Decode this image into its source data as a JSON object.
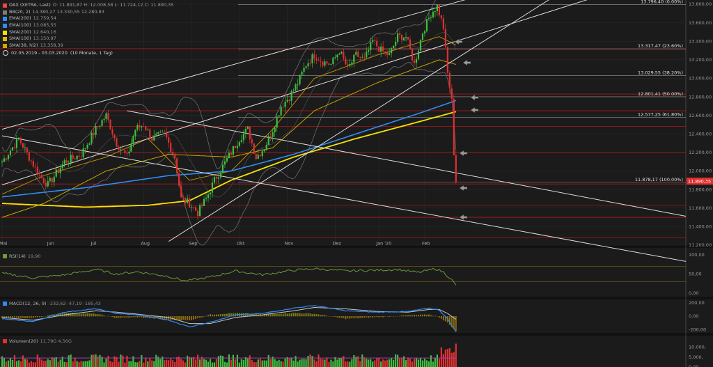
{
  "legend": {
    "main": {
      "name": "DAX (XETRA, Last)",
      "values": "O: 11.891,87  H: 12.008,58  L: 11.724,12  C: 11.890,35",
      "color": "#ff4040"
    },
    "indicators": [
      {
        "name": "BB(20, 2)",
        "values": "14.380,27  13.330,55  12.280,83",
        "color": "#7d7d7d"
      },
      {
        "name": "EMA(200)",
        "values": "12.759,54",
        "color": "#2f8df5"
      },
      {
        "name": "EMA(100)",
        "values": "13.085,55",
        "color": "#2f8df5"
      },
      {
        "name": "SMA(200)",
        "values": "12.640,16",
        "color": "#f5e400"
      },
      {
        "name": "SMA(100)",
        "values": "13.150,97",
        "color": "#e0b800"
      },
      {
        "name": "SMA(38, hl2)",
        "values": "13.358,39",
        "color": "#d9a100"
      }
    ],
    "date_range": "02.05.2019 - 03.03.2020",
    "period": "(10 Monate, 1 Tag)"
  },
  "chart_data": [
    {
      "type": "candlestick",
      "title": "DAX (XETRA, Last)",
      "x": [
        "Mai",
        "Jun",
        "Jul",
        "Aug",
        "Sep",
        "Okt",
        "Nov",
        "Dez",
        "Jan '20",
        "Feb"
      ],
      "y_ticks": [
        "13.800,00",
        "13.600,00",
        "13.400,00",
        "13.200,00",
        "13.000,00",
        "12.800,00",
        "12.600,00",
        "12.400,00",
        "12.200,00",
        "12.000,00",
        "11.800,00",
        "11.600,00",
        "11.400,00",
        "11.200,00"
      ],
      "ylim": [
        11200,
        13800
      ],
      "last_price": "11.890,35",
      "fib_levels": [
        {
          "label": "13.796,40 (0.00%)",
          "value": 13796.4
        },
        {
          "label": "13.317,47 (23.60%)",
          "value": 13317.47
        },
        {
          "label": "13.029,55 (38.20%)",
          "value": 13029.55
        },
        {
          "label": "12.801,41 (50.00%)",
          "value": 12801.41
        },
        {
          "label": "12.577,25 (61.80%)",
          "value": 12577.25
        },
        {
          "label": "11.878,17 (100.00%)",
          "value": 11878.17
        }
      ],
      "support_resistance": [
        13320,
        12830,
        12650,
        12480,
        12200,
        11860,
        11630,
        11500,
        11280
      ],
      "close_anchors": [
        [
          0,
          12100
        ],
        [
          8,
          12350
        ],
        [
          18,
          11950
        ],
        [
          22,
          11850
        ],
        [
          30,
          12100
        ],
        [
          38,
          12180
        ],
        [
          45,
          12450
        ],
        [
          50,
          12600
        ],
        [
          55,
          12300
        ],
        [
          60,
          12150
        ],
        [
          64,
          12450
        ],
        [
          68,
          12500
        ],
        [
          72,
          12350
        ],
        [
          78,
          12400
        ],
        [
          83,
          12150
        ],
        [
          86,
          11700
        ],
        [
          90,
          11650
        ],
        [
          94,
          11550
        ],
        [
          98,
          11700
        ],
        [
          102,
          11900
        ],
        [
          106,
          12050
        ],
        [
          110,
          12200
        ],
        [
          114,
          12350
        ],
        [
          118,
          12450
        ],
        [
          122,
          12150
        ],
        [
          126,
          12250
        ],
        [
          130,
          12450
        ],
        [
          134,
          12700
        ],
        [
          138,
          12800
        ],
        [
          142,
          12950
        ],
        [
          146,
          13150
        ],
        [
          150,
          13250
        ],
        [
          154,
          13180
        ],
        [
          158,
          13150
        ],
        [
          162,
          13300
        ],
        [
          166,
          13100
        ],
        [
          170,
          13250
        ],
        [
          174,
          13200
        ],
        [
          178,
          13400
        ],
        [
          182,
          13300
        ],
        [
          186,
          13250
        ],
        [
          190,
          13450
        ],
        [
          194,
          13450
        ],
        [
          198,
          13150
        ],
        [
          202,
          13500
        ],
        [
          206,
          13700
        ],
        [
          209,
          13780
        ],
        [
          212,
          13550
        ],
        [
          214,
          13050
        ],
        [
          216,
          12750
        ],
        [
          217,
          12200
        ],
        [
          218,
          11890
        ]
      ],
      "ema200_anchors": [
        [
          0,
          11720
        ],
        [
          40,
          11820
        ],
        [
          80,
          11950
        ],
        [
          110,
          12000
        ],
        [
          140,
          12180
        ],
        [
          170,
          12400
        ],
        [
          200,
          12620
        ],
        [
          218,
          12760
        ]
      ],
      "sma200_anchors": [
        [
          0,
          11650
        ],
        [
          40,
          11610
        ],
        [
          70,
          11630
        ],
        [
          90,
          11680
        ],
        [
          110,
          11900
        ],
        [
          140,
          12150
        ],
        [
          170,
          12350
        ],
        [
          200,
          12530
        ],
        [
          218,
          12640
        ]
      ],
      "sma100_anchors": [
        [
          0,
          11500
        ],
        [
          20,
          11650
        ],
        [
          50,
          12000
        ],
        [
          80,
          12180
        ],
        [
          110,
          12150
        ],
        [
          130,
          12250
        ],
        [
          150,
          12650
        ],
        [
          180,
          12950
        ],
        [
          210,
          13200
        ],
        [
          218,
          13150
        ]
      ],
      "sma38_anchors": [
        [
          0,
          11750
        ],
        [
          20,
          11950
        ],
        [
          50,
          12150
        ],
        [
          70,
          12350
        ],
        [
          90,
          11900
        ],
        [
          110,
          12000
        ],
        [
          130,
          12450
        ],
        [
          150,
          13000
        ],
        [
          180,
          13250
        ],
        [
          210,
          13450
        ],
        [
          218,
          13358
        ]
      ]
    },
    {
      "type": "line",
      "name": "RSI(14)",
      "value_label": "19,90",
      "y_ticks": [
        "100,00",
        "50,00",
        "0,00"
      ],
      "ylim": [
        0,
        100
      ],
      "levels": [
        70,
        30
      ],
      "anchors": [
        [
          0,
          52
        ],
        [
          15,
          40
        ],
        [
          30,
          48
        ],
        [
          45,
          62
        ],
        [
          55,
          50
        ],
        [
          65,
          56
        ],
        [
          80,
          44
        ],
        [
          88,
          32
        ],
        [
          100,
          42
        ],
        [
          112,
          58
        ],
        [
          125,
          48
        ],
        [
          140,
          60
        ],
        [
          150,
          64
        ],
        [
          165,
          58
        ],
        [
          180,
          60
        ],
        [
          190,
          62
        ],
        [
          200,
          54
        ],
        [
          208,
          64
        ],
        [
          212,
          55
        ],
        [
          216,
          35
        ],
        [
          218,
          20
        ]
      ]
    },
    {
      "type": "line",
      "name": "MACD(12, 26, 9)",
      "value_label": "-232,62  -47,19  -185,43",
      "y_ticks": [
        "200,00",
        "0,00",
        "-200,00"
      ],
      "ylim": [
        -250,
        250
      ],
      "macd_anchors": [
        [
          0,
          -40
        ],
        [
          15,
          -80
        ],
        [
          30,
          60
        ],
        [
          45,
          110
        ],
        [
          55,
          40
        ],
        [
          65,
          20
        ],
        [
          80,
          -60
        ],
        [
          90,
          -160
        ],
        [
          100,
          -90
        ],
        [
          112,
          20
        ],
        [
          125,
          40
        ],
        [
          140,
          120
        ],
        [
          150,
          160
        ],
        [
          165,
          80
        ],
        [
          180,
          60
        ],
        [
          195,
          70
        ],
        [
          205,
          120
        ],
        [
          210,
          90
        ],
        [
          214,
          -40
        ],
        [
          218,
          -232
        ]
      ],
      "signal_anchors": [
        [
          0,
          -20
        ],
        [
          15,
          -60
        ],
        [
          30,
          20
        ],
        [
          45,
          80
        ],
        [
          55,
          60
        ],
        [
          65,
          30
        ],
        [
          80,
          -20
        ],
        [
          90,
          -110
        ],
        [
          100,
          -110
        ],
        [
          112,
          -20
        ],
        [
          125,
          20
        ],
        [
          140,
          80
        ],
        [
          150,
          130
        ],
        [
          165,
          110
        ],
        [
          180,
          70
        ],
        [
          195,
          60
        ],
        [
          205,
          100
        ],
        [
          210,
          100
        ],
        [
          214,
          40
        ],
        [
          218,
          -47
        ]
      ]
    },
    {
      "type": "bar",
      "name": "Volumen(20)",
      "value_label": "11,79G  4,56G",
      "y_ticks": [
        "10.000,",
        "5.000,",
        "0,00"
      ],
      "ylim": [
        0,
        13000
      ],
      "avg_volume": 4560,
      "last_volume": 11790
    }
  ]
}
